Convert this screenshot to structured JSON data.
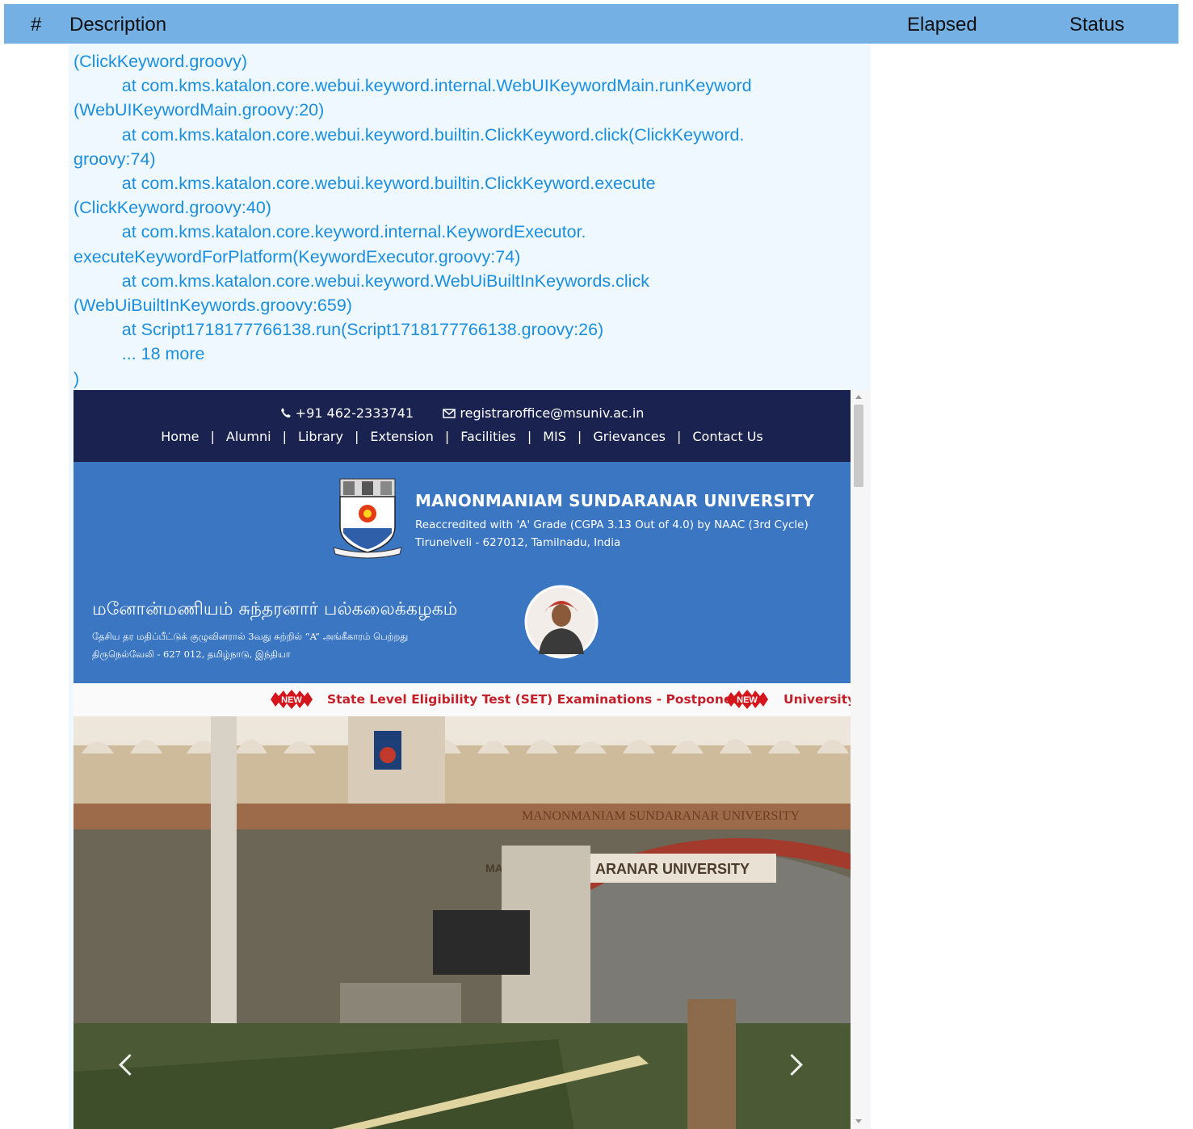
{
  "report": {
    "columns": {
      "index": "#",
      "description": "Description",
      "elapsed": "Elapsed",
      "status": "Status"
    }
  },
  "log": {
    "lines": [
      "(ClickKeyword.groovy)",
      "          at com.kms.katalon.core.webui.keyword.internal.WebUIKeywordMain.runKeyword",
      "(WebUIKeywordMain.groovy:20)",
      "          at com.kms.katalon.core.webui.keyword.builtin.ClickKeyword.click(ClickKeyword.",
      "groovy:74)",
      "          at com.kms.katalon.core.webui.keyword.builtin.ClickKeyword.execute",
      "(ClickKeyword.groovy:40)",
      "          at com.kms.katalon.core.keyword.internal.KeywordExecutor.",
      "executeKeywordForPlatform(KeywordExecutor.groovy:74)",
      "          at com.kms.katalon.core.webui.keyword.WebUiBuiltInKeywords.click",
      "(WebUiBuiltInKeywords.groovy:659)",
      "          at Script1718177766138.run(Script1718177766138.groovy:26)",
      "          ... 18 more",
      ")"
    ]
  },
  "site": {
    "phone": "+91 462-2333741",
    "email": "registraroffice@msuniv.ac.in",
    "nav": [
      "Home",
      "Alumni",
      "Library",
      "Extension",
      "Facilities",
      "MIS",
      "Grievances",
      "Contact Us"
    ],
    "nav_separator": "|",
    "university_name": "MANONMANIAM SUNDARANAR UNIVERSITY",
    "accreditation": "Reaccredited with 'A' Grade (CGPA 3.13 Out of 4.0) by NAAC (3rd Cycle)",
    "location": "Tirunelveli - 627012, Tamilnadu, India",
    "tamil_name": "மனோன்மணியம் சுந்தரனார் பல்கலைக்கழகம்",
    "tamil_line1": "தேசிய தர மதிப்பீட்டுக் குழுவினரால் 3வது சுற்றில் “A” அங்கீகாரம் பெற்றது",
    "tamil_line2": "திருநெல்வேலி - 627 012, தமிழ்நாடு, இந்தியா",
    "new_badge": "NEW",
    "ticker": [
      "State Level Eligibility Test (SET) Examinations - Postponed",
      "University"
    ],
    "photo_signage": [
      "MANONMANIAM SUNDARANAR UNIVERSITY",
      "ARANAR UNIVERSITY",
      "MAN"
    ]
  },
  "colors": {
    "header_bg": "#74b0e4",
    "log_bg": "#f0f8ff",
    "log_text": "#1a8fe0",
    "site_topbar": "#1a234f",
    "site_banner": "#3a76c2",
    "ticker_text": "#c5202a"
  },
  "icons": [
    "phone-icon",
    "envelope-icon",
    "chevron-left-icon",
    "chevron-right-icon",
    "scroll-up-icon",
    "scroll-down-icon"
  ]
}
